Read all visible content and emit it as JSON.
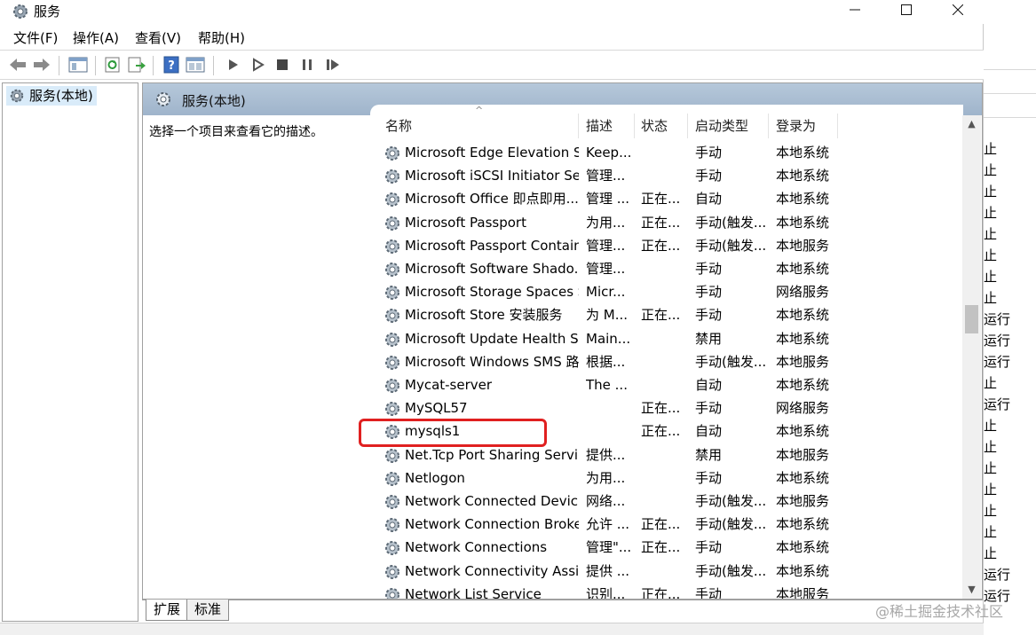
{
  "window": {
    "title": "服务",
    "icon": "services-gear-icon",
    "controls": [
      "minimize",
      "maximize",
      "close"
    ]
  },
  "menu": [
    "文件(F)",
    "操作(A)",
    "查看(V)",
    "帮助(H)"
  ],
  "toolbar": {
    "icons": [
      "back-arrow-icon",
      "forward-arrow-icon",
      "show-console-tree-icon",
      "refresh-icon",
      "export-list-icon",
      "help-icon",
      "properties-icon",
      "start-service-icon",
      "start-service-params-icon",
      "stop-service-icon",
      "pause-service-icon",
      "restart-service-icon"
    ]
  },
  "tree": {
    "selected_label": "服务(本地)"
  },
  "pane": {
    "header": "服务(本地)",
    "description_prompt": "选择一个项目来查看它的描述。"
  },
  "columns": {
    "name": "名称",
    "description": "描述",
    "status": "状态",
    "startup": "启动类型",
    "logon": "登录为"
  },
  "services": [
    {
      "name": "Microsoft Edge Elevation S...",
      "desc": "Keep...",
      "status": "",
      "startup": "手动",
      "logon": "本地系统"
    },
    {
      "name": "Microsoft iSCSI Initiator Ser...",
      "desc": "管理...",
      "status": "",
      "startup": "手动",
      "logon": "本地系统"
    },
    {
      "name": "Microsoft Office 即点即用...",
      "desc": "管理 ...",
      "status": "正在...",
      "startup": "自动",
      "logon": "本地系统"
    },
    {
      "name": "Microsoft Passport",
      "desc": "为用...",
      "status": "正在...",
      "startup": "手动(触发...",
      "logon": "本地系统"
    },
    {
      "name": "Microsoft Passport Container",
      "desc": "管理...",
      "status": "正在...",
      "startup": "手动(触发...",
      "logon": "本地服务"
    },
    {
      "name": "Microsoft Software Shado...",
      "desc": "管理...",
      "status": "",
      "startup": "手动",
      "logon": "本地系统"
    },
    {
      "name": "Microsoft Storage Spaces S...",
      "desc": "Micr...",
      "status": "",
      "startup": "手动",
      "logon": "网络服务"
    },
    {
      "name": "Microsoft Store 安装服务",
      "desc": "为 M...",
      "status": "正在...",
      "startup": "手动",
      "logon": "本地系统"
    },
    {
      "name": "Microsoft Update Health S...",
      "desc": "Main...",
      "status": "",
      "startup": "禁用",
      "logon": "本地系统"
    },
    {
      "name": "Microsoft Windows SMS 路...",
      "desc": "根据...",
      "status": "",
      "startup": "手动(触发...",
      "logon": "本地服务"
    },
    {
      "name": "Mycat-server",
      "desc": "The ...",
      "status": "",
      "startup": "自动",
      "logon": "本地系统"
    },
    {
      "name": "MySQL57",
      "desc": "",
      "status": "正在...",
      "startup": "手动",
      "logon": "网络服务"
    },
    {
      "name": "mysqls1",
      "desc": "",
      "status": "正在...",
      "startup": "自动",
      "logon": "本地系统"
    },
    {
      "name": "Net.Tcp Port Sharing Service",
      "desc": "提供...",
      "status": "",
      "startup": "禁用",
      "logon": "本地服务"
    },
    {
      "name": "Netlogon",
      "desc": "为用...",
      "status": "",
      "startup": "手动",
      "logon": "本地系统"
    },
    {
      "name": "Network Connected Devic...",
      "desc": "网络...",
      "status": "",
      "startup": "手动(触发...",
      "logon": "本地服务"
    },
    {
      "name": "Network Connection Broker",
      "desc": "允许 ...",
      "status": "正在...",
      "startup": "手动(触发...",
      "logon": "本地系统"
    },
    {
      "name": "Network Connections",
      "desc": "管理\"...",
      "status": "正在...",
      "startup": "手动",
      "logon": "本地系统"
    },
    {
      "name": "Network Connectivity Assis...",
      "desc": "提供 ...",
      "status": "",
      "startup": "手动(触发...",
      "logon": "本地系统"
    },
    {
      "name": "Network List Service",
      "desc": "识别...",
      "status": "正在...",
      "startup": "手动",
      "logon": "本地服务"
    }
  ],
  "highlight_color": "#e02020",
  "tabs": [
    "扩展",
    "标准"
  ],
  "background_window": {
    "cells": [
      "止",
      "止",
      "止",
      "止",
      "止",
      "止",
      "止",
      "止",
      "运行",
      "运行",
      "运行",
      "止",
      "运行",
      "止",
      "止",
      "止",
      "止",
      "止",
      "止",
      "止",
      "运行",
      "运行"
    ]
  },
  "watermark": "@稀土掘金技术社区"
}
